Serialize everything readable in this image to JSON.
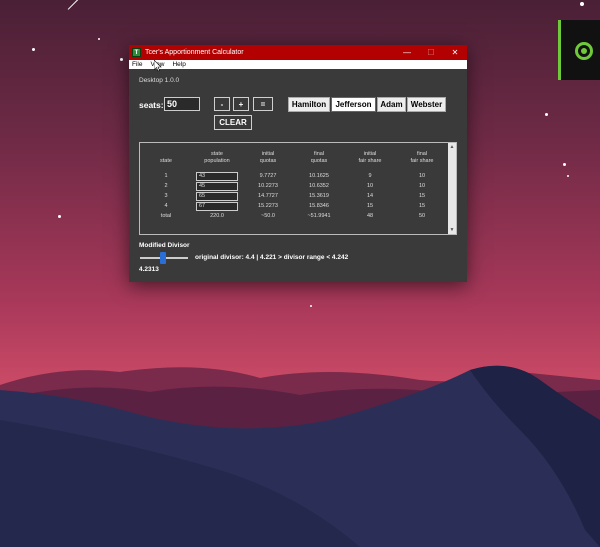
{
  "window": {
    "title": "Tcer's Apportionment Calculator",
    "icon_letter": "T",
    "minimize": "—",
    "maximize": "☐",
    "close": "✕"
  },
  "menu": [
    "File",
    "View",
    "Help"
  ],
  "version": "Desktop 1.0.0",
  "seats": {
    "label": "seats:",
    "value": "50"
  },
  "buttons": {
    "minus": "-",
    "plus": "+",
    "equals": "=",
    "clear": "CLEAR"
  },
  "methods": [
    {
      "label": "Hamilton",
      "active": false
    },
    {
      "label": "Jefferson",
      "active": true
    },
    {
      "label": "Adam",
      "active": false
    },
    {
      "label": "Webster",
      "active": false
    }
  ],
  "table": {
    "headers": [
      [
        "state"
      ],
      [
        "state",
        "population"
      ],
      [
        "initial",
        "quotas"
      ],
      [
        "final",
        "quotas"
      ],
      [
        "initial",
        "fair share"
      ],
      [
        "final",
        "fair share"
      ]
    ],
    "rows": [
      {
        "state": "1",
        "population": "43",
        "initial_quota": "9.7727",
        "final_quota": "10.1625",
        "initial_fair": "9",
        "final_fair": "10"
      },
      {
        "state": "2",
        "population": "45",
        "initial_quota": "10.2273",
        "final_quota": "10.6352",
        "initial_fair": "10",
        "final_fair": "10"
      },
      {
        "state": "3",
        "population": "65",
        "initial_quota": "14.7727",
        "final_quota": "15.3619",
        "initial_fair": "14",
        "final_fair": "15"
      },
      {
        "state": "4",
        "population": "67",
        "initial_quota": "15.2273",
        "final_quota": "15.8346",
        "initial_fair": "15",
        "final_fair": "15"
      }
    ],
    "total": {
      "state": "total",
      "population": "220.0",
      "initial_quota": "~50.0",
      "final_quota": "~51.9941",
      "initial_fair": "48",
      "final_fair": "50"
    }
  },
  "divisor": {
    "label": "Modified Divisor",
    "info": "original divisor: 4.4  |  4.221 > divisor range < 4.242",
    "value": "4.2313"
  },
  "colors": {
    "titlebar": "#b30000",
    "window_bg": "#3a3a3a",
    "accent": "#2a6fd6",
    "widget": "#6fc93a"
  }
}
